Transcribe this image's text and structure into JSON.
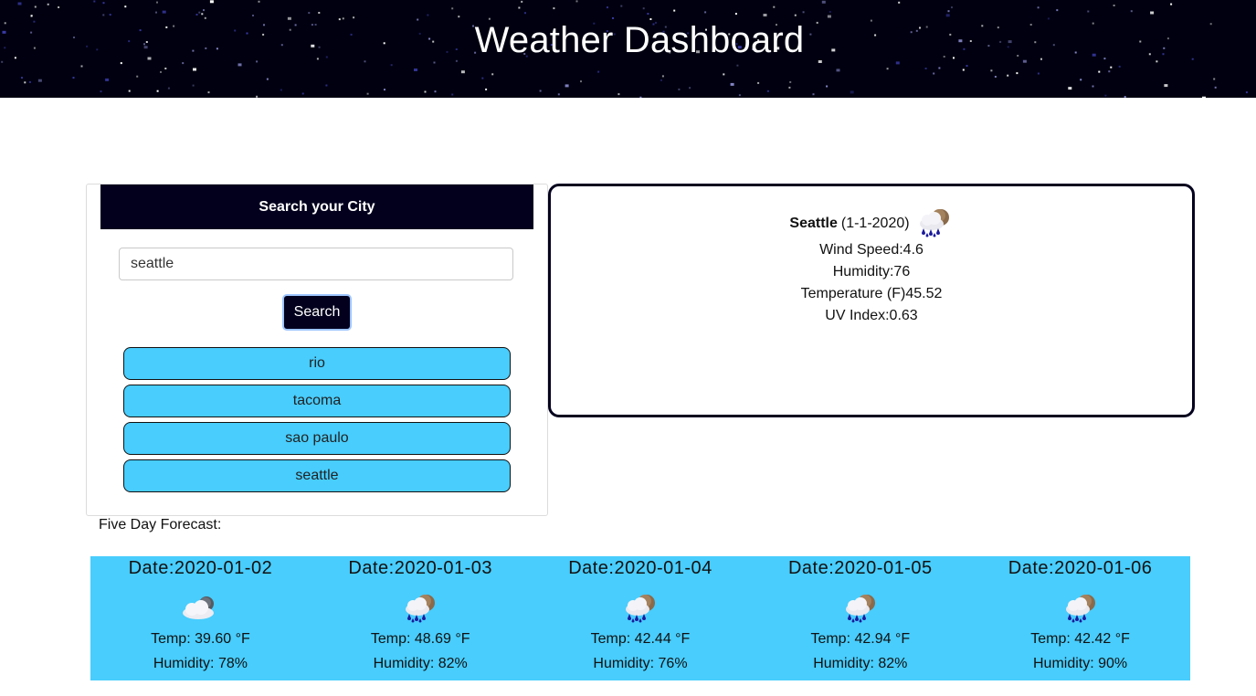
{
  "header": {
    "title": "Weather Dashboard"
  },
  "search": {
    "heading": "Search your City",
    "input_value": "seattle",
    "button_label": "Search",
    "history": [
      "rio",
      "tacoma",
      "sao paulo",
      "seattle"
    ]
  },
  "current": {
    "city": "Seattle",
    "date": "(1-1-2020)",
    "icon": "rain-cloud-sun-icon",
    "wind": "Wind Speed:4.6",
    "humidity": "Humidity:76",
    "temperature": "Temperature (F)45.52",
    "uv": "UV Index:0.63"
  },
  "forecast": {
    "label": "Five Day Forecast:",
    "days": [
      {
        "date": "Date:2020-01-02",
        "icon": "cloud-sun-icon",
        "temp": "Temp: 39.60 °F",
        "humidity": "Humidity: 78%"
      },
      {
        "date": "Date:2020-01-03",
        "icon": "rain-cloud-sun-icon",
        "temp": "Temp: 48.69 °F",
        "humidity": "Humidity: 82%"
      },
      {
        "date": "Date:2020-01-04",
        "icon": "rain-cloud-sun-icon",
        "temp": "Temp: 42.44 °F",
        "humidity": "Humidity: 76%"
      },
      {
        "date": "Date:2020-01-05",
        "icon": "rain-cloud-sun-icon",
        "temp": "Temp: 42.94 °F",
        "humidity": "Humidity: 82%"
      },
      {
        "date": "Date:2020-01-06",
        "icon": "rain-cloud-sun-icon",
        "temp": "Temp: 42.42 °F",
        "humidity": "Humidity: 90%"
      }
    ]
  },
  "colors": {
    "navy": "#03001e",
    "sky": "#48cdfd"
  }
}
